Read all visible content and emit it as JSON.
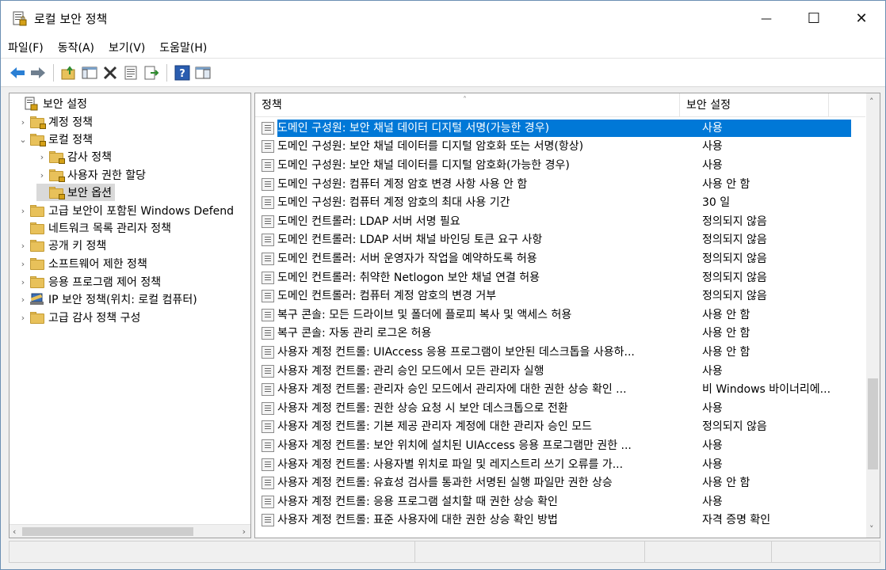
{
  "window": {
    "title": "로컬 보안 정책",
    "minimize": "—",
    "maximize": "☐",
    "close": "✕"
  },
  "menu": [
    {
      "label": "파일(F)"
    },
    {
      "label": "동작(A)"
    },
    {
      "label": "보기(V)"
    },
    {
      "label": "도움말(H)"
    }
  ],
  "toolbar": {
    "icons": [
      "back-icon",
      "forward-icon",
      "up-folder-icon",
      "show-hide-tree-icon",
      "delete-icon",
      "properties-icon",
      "export-list-icon",
      "help-icon",
      "view-icon"
    ]
  },
  "tree": [
    {
      "label": "보안 설정",
      "expander": ""
    },
    {
      "label": "계정 정책",
      "expander": "›"
    },
    {
      "label": "로컬 정책",
      "expander": "⌄"
    },
    {
      "label": "감사 정책",
      "expander": "›"
    },
    {
      "label": "사용자 권한 할당",
      "expander": "›"
    },
    {
      "label": "보안 옵션",
      "expander": ""
    },
    {
      "label": "고급 보안이 포함된 Windows Defend",
      "expander": "›"
    },
    {
      "label": "네트워크 목록 관리자 정책",
      "expander": ""
    },
    {
      "label": "공개 키 정책",
      "expander": "›"
    },
    {
      "label": "소프트웨어 제한 정책",
      "expander": "›"
    },
    {
      "label": "응용 프로그램 제어 정책",
      "expander": "›"
    },
    {
      "label": "IP 보안 정책(위치: 로컬 컴퓨터)",
      "expander": "›"
    },
    {
      "label": "고급 감사 정책 구성",
      "expander": "›"
    }
  ],
  "list": {
    "col_policy": "정책",
    "col_setting": "보안 설정",
    "sort_indicator": "˄",
    "rows": [
      {
        "policy": "도메인 구성원: 보안 채널 데이터 디지털 서명(가능한 경우)",
        "setting": "사용"
      },
      {
        "policy": "도메인 구성원: 보안 채널 데이터를 디지털 암호화 또는 서명(항상)",
        "setting": "사용"
      },
      {
        "policy": "도메인 구성원: 보안 채널 데이터를 디지털 암호화(가능한 경우)",
        "setting": "사용"
      },
      {
        "policy": "도메인 구성원: 컴퓨터 계정 암호 변경 사항 사용 안 함",
        "setting": "사용 안 함"
      },
      {
        "policy": "도메인 구성원: 컴퓨터 계정 암호의 최대 사용 기간",
        "setting": "30 일"
      },
      {
        "policy": "도메인 컨트롤러: LDAP 서버 서명 필요",
        "setting": "정의되지 않음"
      },
      {
        "policy": "도메인 컨트롤러: LDAP 서버 채널 바인딩 토큰 요구 사항",
        "setting": "정의되지 않음"
      },
      {
        "policy": "도메인 컨트롤러: 서버 운영자가 작업을 예약하도록 허용",
        "setting": "정의되지 않음"
      },
      {
        "policy": "도메인 컨트롤러: 취약한 Netlogon 보안 채널 연결 허용",
        "setting": "정의되지 않음"
      },
      {
        "policy": "도메인 컨트롤러: 컴퓨터 계정 암호의 변경 거부",
        "setting": "정의되지 않음"
      },
      {
        "policy": "복구 콘솔: 모든 드라이브 및 폴더에 플로피 복사 및 액세스 허용",
        "setting": "사용 안 함"
      },
      {
        "policy": "복구 콘솔: 자동 관리 로그온 허용",
        "setting": "사용 안 함"
      },
      {
        "policy": "사용자 계정 컨트롤: UIAccess 응용 프로그램이 보안된 데스크톱을 사용하...",
        "setting": "사용 안 함"
      },
      {
        "policy": "사용자 계정 컨트롤: 관리 승인 모드에서 모든 관리자 실행",
        "setting": "사용"
      },
      {
        "policy": "사용자 계정 컨트롤: 관리자 승인 모드에서 관리자에 대한 권한 상승 확인 ...",
        "setting": "비 Windows 바이너리에..."
      },
      {
        "policy": "사용자 계정 컨트롤: 권한 상승 요청 시 보안 데스크톱으로 전환",
        "setting": "사용"
      },
      {
        "policy": "사용자 계정 컨트롤: 기본 제공 관리자 계정에 대한 관리자 승인 모드",
        "setting": "정의되지 않음"
      },
      {
        "policy": "사용자 계정 컨트롤: 보안 위치에 설치된 UIAccess 응용 프로그램만 권한 ...",
        "setting": "사용"
      },
      {
        "policy": "사용자 계정 컨트롤: 사용자별 위치로 파일 및 레지스트리 쓰기 오류를 가...",
        "setting": "사용"
      },
      {
        "policy": "사용자 계정 컨트롤: 유효성 검사를 통과한 서명된 실행 파일만 권한 상승",
        "setting": "사용 안 함"
      },
      {
        "policy": "사용자 계정 컨트롤: 응용 프로그램 설치할 때 권한 상승 확인",
        "setting": "사용"
      },
      {
        "policy": "사용자 계정 컨트롤: 표준 사용자에 대한 권한 상승 확인 방법",
        "setting": "자격 증명 확인"
      }
    ]
  },
  "colors": {
    "selection": "#0078d7",
    "folder": "#e8c15a"
  }
}
